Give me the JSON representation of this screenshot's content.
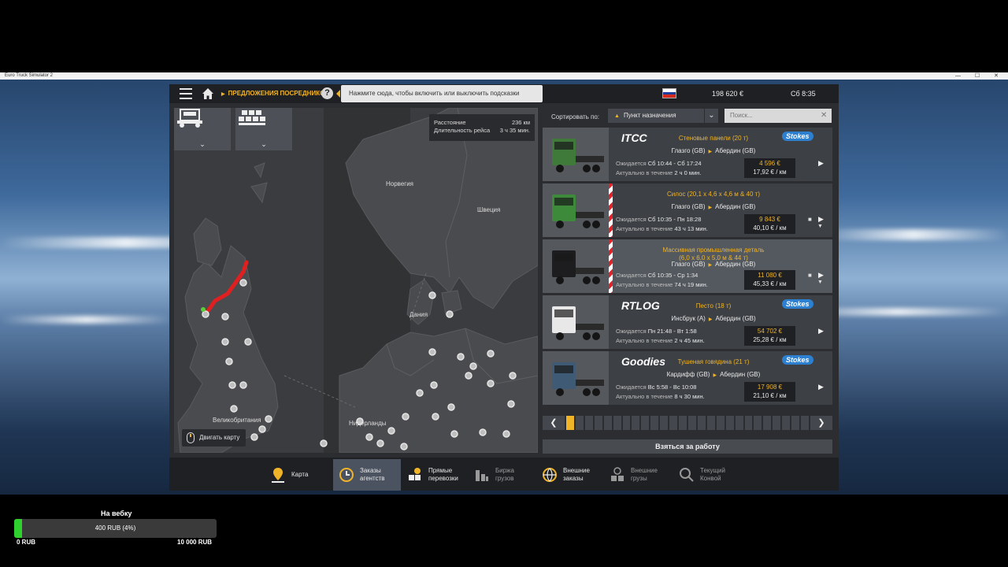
{
  "window": {
    "title": "Euro Truck Simulator 2"
  },
  "topbar": {
    "breadcrumb": "ПРЕДЛОЖЕНИЯ ПОСРЕДНИКОВ",
    "tip": "Нажмите сюда, чтобы включить или выключить подсказки",
    "flag": [
      "#ffffff",
      "#1c3f9e",
      "#d52b1e"
    ],
    "money": "198 620 €",
    "time": "Сб 8:35"
  },
  "map": {
    "route_info": {
      "distance_label": "Расстояние",
      "distance_value": "236 км",
      "duration_label": "Длительность рейса",
      "duration_value": "3 ч 35 мин."
    },
    "labels": {
      "norway": "Норвегия",
      "sweden": "Швеция",
      "denmark": "Дания",
      "britain": "Великобритания",
      "netherlands": "Нидерланды"
    },
    "move_button": "Двигать карту"
  },
  "sort": {
    "label": "Сортировать по:",
    "selected": "Пункт назначения",
    "search_placeholder": "Поиск..."
  },
  "jobs": [
    {
      "company": "ITCC",
      "receiver": "Stokes",
      "cargo": "Стеновые панели (20 т)",
      "from": "Глазго (GB)",
      "to": "Абердин (GB)",
      "waiting_label": "Ожидается",
      "waiting": "Сб 10:44 - Сб 17:24",
      "valid_label": "Актуально в течение",
      "valid": "2 ч 0 мин.",
      "price": "4 596 €",
      "rate": "17,92 € / км",
      "truck_color": "#3f7a3a",
      "stripe": false,
      "selected": false
    },
    {
      "company": "",
      "receiver": "",
      "cargo": "Силос (20,1 x 4,6 x 4,6 м & 40 т)",
      "from": "Глазго (GB)",
      "to": "Абердин (GB)",
      "waiting_label": "Ожидается",
      "waiting": "Сб 10:35 - Пн 18:28",
      "valid_label": "Актуально в течение",
      "valid": "43 ч 13 мин.",
      "price": "9 843 €",
      "rate": "40,10 € / км",
      "truck_color": "#3c8a3a",
      "stripe": true,
      "selected": false
    },
    {
      "company": "",
      "receiver": "",
      "cargo": "Массивная промышленная деталь",
      "cargo2": "(6,0 x 6,0 x 5,0 м & 44 т)",
      "from": "Глазго (GB)",
      "to": "Абердин (GB)",
      "waiting_label": "Ожидается",
      "waiting": "Сб 10:35 - Ср 1:34",
      "valid_label": "Актуально в течение",
      "valid": "74 ч 19 мин.",
      "price": "11 080 €",
      "rate": "45,33 € / км",
      "truck_color": "#1d1d1f",
      "stripe": true,
      "selected": true
    },
    {
      "company": "RTLOG",
      "receiver": "Stokes",
      "cargo": "Песто (18 т)",
      "from": "Инсбрук (A)",
      "to": "Абердин (GB)",
      "waiting_label": "Ожидается",
      "waiting": "Пн 21:48 - Вт 1:58",
      "valid_label": "Актуально в течение",
      "valid": "2 ч 45 мин.",
      "price": "54 702 €",
      "rate": "25,28 € / км",
      "truck_color": "#e8e8e8",
      "stripe": false,
      "selected": false
    },
    {
      "company": "Goodies",
      "receiver": "Stokes",
      "cargo": "Тушеная говядина (21 т)",
      "from": "Кардифф (GB)",
      "to": "Абердин (GB)",
      "waiting_label": "Ожидается",
      "waiting": "Вс 5:58 - Вс 10:08",
      "valid_label": "Актуально в течение",
      "valid": "8 ч 30 мин.",
      "price": "17 908 €",
      "rate": "21,10 € / км",
      "truck_color": "#3e5a74",
      "stripe": false,
      "selected": false
    }
  ],
  "pager": {
    "page_count": 26,
    "current": 1
  },
  "take_job": "Взяться за работу",
  "nav": [
    {
      "l1": "Карта",
      "l2": "",
      "icon": "map-pin-icon"
    },
    {
      "l1": "Заказы",
      "l2": "агентств",
      "icon": "clock-icon"
    },
    {
      "l1": "Прямые",
      "l2": "перевозки",
      "icon": "cargo-icon"
    },
    {
      "l1": "Биржа",
      "l2": "грузов",
      "icon": "exchange-icon"
    },
    {
      "l1": "Внешние",
      "l2": "заказы",
      "icon": "globe-icon"
    },
    {
      "l1": "Внешние",
      "l2": "грузы",
      "icon": "external-cargo-icon"
    },
    {
      "l1": "Текущий",
      "l2": "Конвой",
      "icon": "convoy-icon"
    }
  ],
  "widget": {
    "title": "На вебку",
    "progress_text": "400 RUB (4%)",
    "progress_fraction": 0.04,
    "min": "0 RUB",
    "max": "10 000 RUB",
    "fill_color": "#2ed12e"
  }
}
